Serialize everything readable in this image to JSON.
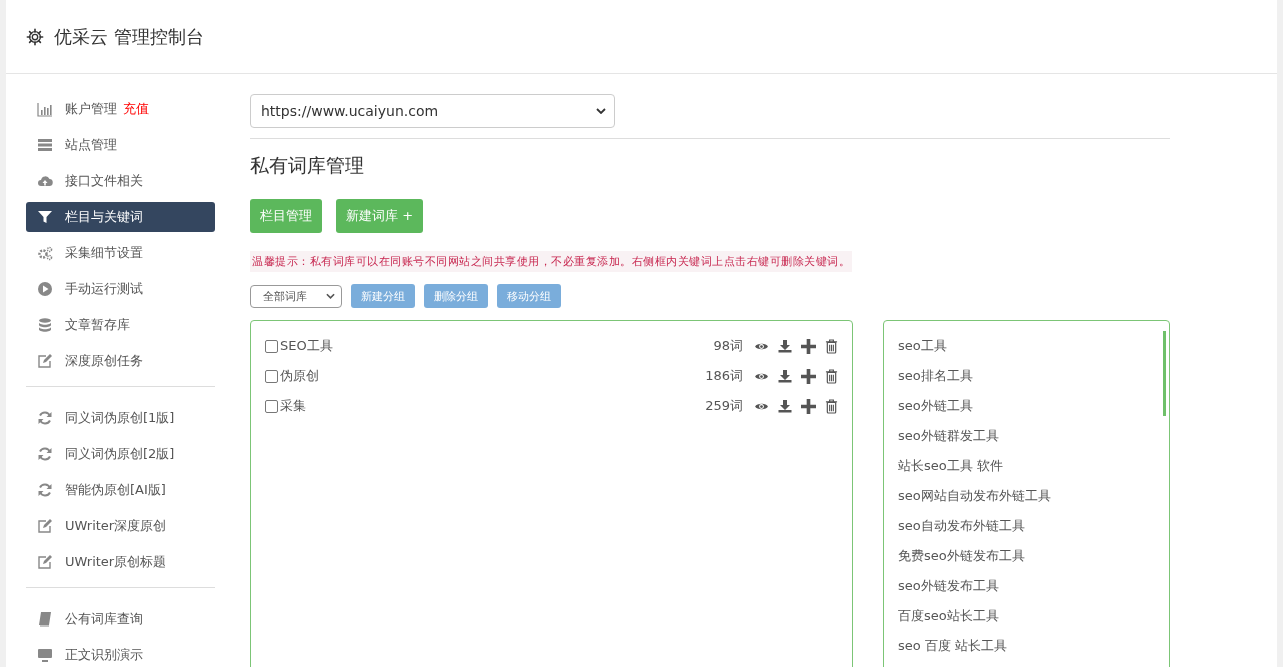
{
  "header": {
    "title": "优采云 管理控制台"
  },
  "sidebar": {
    "groups": [
      {
        "items": [
          {
            "label": "账户管理",
            "badge": "充值",
            "selected": false
          },
          {
            "label": "站点管理",
            "selected": false
          },
          {
            "label": "接口文件相关",
            "selected": false
          },
          {
            "label": "栏目与关键词",
            "selected": true
          },
          {
            "label": "采集细节设置",
            "selected": false
          },
          {
            "label": "手动运行测试",
            "selected": false
          },
          {
            "label": "文章暂存库",
            "selected": false
          },
          {
            "label": "深度原创任务",
            "selected": false
          }
        ]
      },
      {
        "items": [
          {
            "label": "同义词伪原创[1版]",
            "selected": false
          },
          {
            "label": "同义词伪原创[2版]",
            "selected": false
          },
          {
            "label": "智能伪原创[AI版]",
            "selected": false
          },
          {
            "label": "UWriter深度原创",
            "selected": false
          },
          {
            "label": "UWriter原创标题",
            "selected": false
          }
        ]
      },
      {
        "items": [
          {
            "label": "公有词库查询",
            "selected": false
          },
          {
            "label": "正文识别演示",
            "selected": false
          }
        ]
      }
    ]
  },
  "site_select": {
    "value": "https://www.ucaiyun.com"
  },
  "page_title": "私有词库管理",
  "top_buttons": [
    "栏目管理",
    "新建词库 +"
  ],
  "notice": "温馨提示：私有词库可以在同账号不同网站之间共享使用，不必重复添加。右侧框内关键词上点击右键可删除关键词。",
  "group_select": {
    "value": "全部词库"
  },
  "group_buttons": [
    "新建分组",
    "删除分组",
    "移动分组"
  ],
  "libraries": [
    {
      "name": "SEO工具",
      "count": "98词",
      "checked": false
    },
    {
      "name": "伪原创",
      "count": "186词",
      "checked": false
    },
    {
      "name": "采集",
      "count": "259词",
      "checked": false
    }
  ],
  "keywords": [
    "seo工具",
    "seo排名工具",
    "seo外链工具",
    "seo外链群发工具",
    "站长seo工具 软件",
    "seo网站自动发布外链工具",
    "seo自动发布外链工具",
    "免费seo外链发布工具",
    "seo外链发布工具",
    "百度seo站长工具",
    "seo 百度 站长工具"
  ]
}
